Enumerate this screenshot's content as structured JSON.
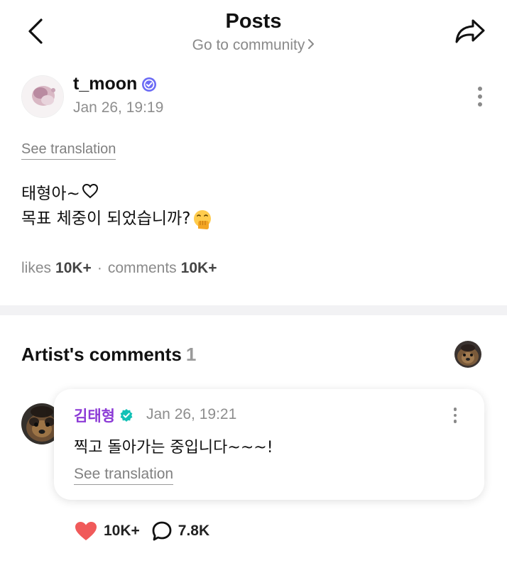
{
  "header": {
    "title": "Posts",
    "community_link": "Go to community"
  },
  "post": {
    "author": "t_moon",
    "date": "Jan 26, 19:19",
    "see_translation": "See translation",
    "line1": "태형아~",
    "line2": "목표 체중이 되었습니까?",
    "stats": {
      "likes_label": "likes",
      "likes_value": "10K+",
      "separator": "·",
      "comments_label": "comments",
      "comments_value": "10K+"
    }
  },
  "artist_comments": {
    "title": "Artist's comments",
    "count": "1"
  },
  "comment": {
    "author": "김태형",
    "date": "Jan 26, 19:21",
    "text": "찍고 돌아가는 중입니다~~~!",
    "see_translation": "See translation"
  },
  "actions": {
    "like_count": "10K+",
    "comment_count": "7.8K"
  },
  "icons": {
    "back": "chevron-left-icon",
    "share": "share-arrow-icon",
    "more": "more-vertical-icon",
    "verified": "verified-badge-icon",
    "heart": "heart-icon",
    "comment": "speech-bubble-icon"
  },
  "colors": {
    "verified_badge": "#6b6bf5",
    "artist_name": "#8c3bd6",
    "artist_verified": "#12c1b6",
    "heart": "#f05a5a",
    "muted": "#8a8a8a"
  }
}
